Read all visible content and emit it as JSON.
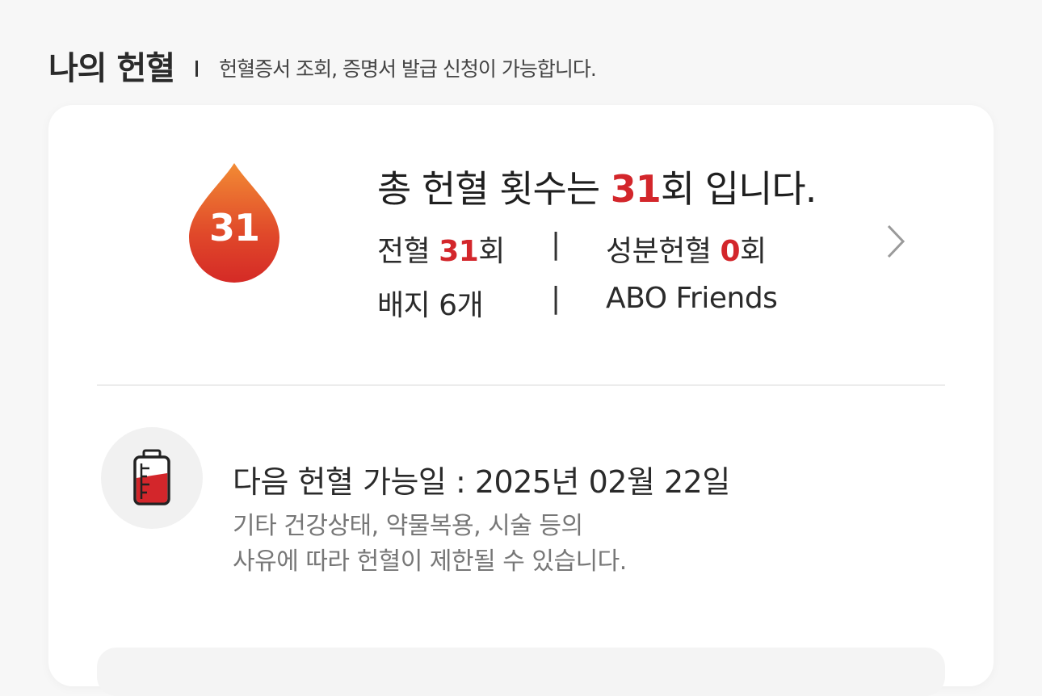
{
  "header": {
    "title": "나의 헌혈",
    "description": "헌혈증서 조회, 증명서 발급 신청이 가능합니다."
  },
  "summary": {
    "drop_count": "31",
    "total_prefix": "총 헌혈 횟수는 ",
    "total_count": "31",
    "total_suffix": "회 입니다.",
    "whole_blood_label": "전혈 ",
    "whole_blood_count": "31",
    "whole_blood_unit": "회",
    "apheresis_label": "성분헌혈 ",
    "apheresis_count": "0",
    "apheresis_unit": "회",
    "badge_text": "배지 6개",
    "separator": "|",
    "group_name": "ABO Friends"
  },
  "next_donation": {
    "date_text": "다음 헌혈 가능일 : 2025년 02월 22일",
    "notice_line1": "기타 건강상태, 약물복용, 시술 등의",
    "notice_line2": "사유에 따라 헌혈이 제한될 수 있습니다."
  },
  "colors": {
    "accent_red": "#d3262b",
    "drop_top": "#f08a36",
    "drop_bottom": "#d52a26"
  }
}
